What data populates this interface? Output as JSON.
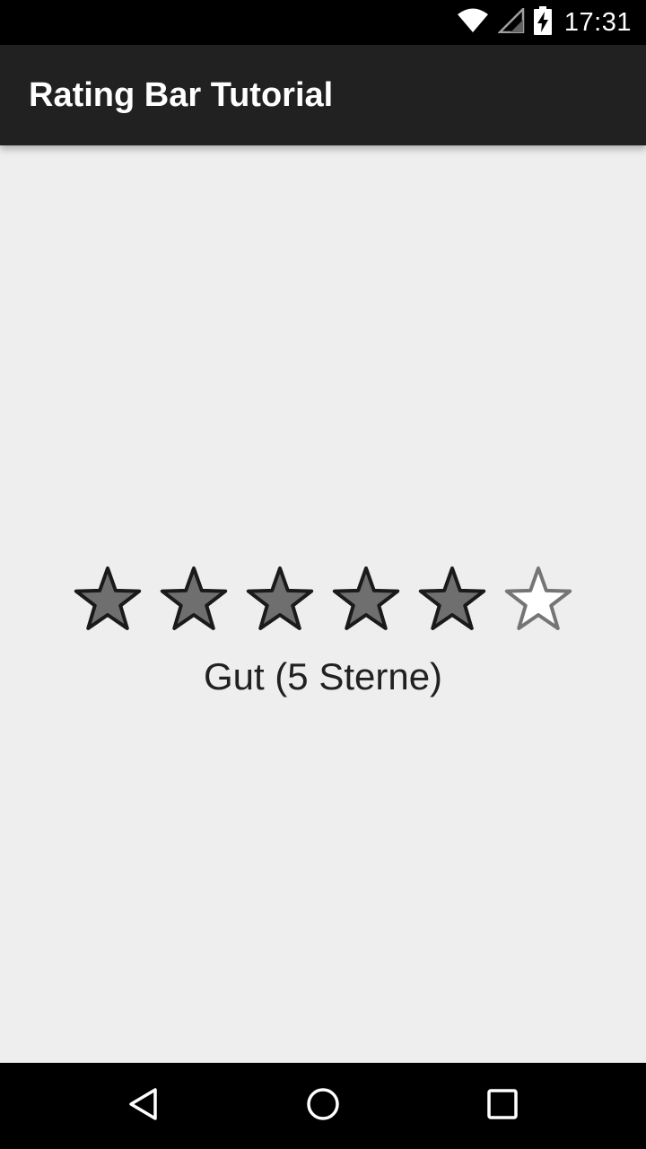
{
  "status_bar": {
    "time": "17:31",
    "icons": [
      "wifi-icon",
      "cell-signal-icon",
      "battery-charging-icon"
    ]
  },
  "app_bar": {
    "title": "Rating Bar Tutorial"
  },
  "rating": {
    "max_stars": 6,
    "filled_stars": 5,
    "label": "Gut (5 Sterne)"
  },
  "nav_bar": {
    "buttons": [
      "back-icon",
      "home-icon",
      "recents-icon"
    ]
  },
  "colors": {
    "status_bar_bg": "#000000",
    "app_bar_bg": "#212121",
    "content_bg": "#eeeeee",
    "star_filled": "#6f6f6f",
    "star_outline": "#1a1a1a",
    "star_empty_outline": "#757575",
    "nav_bar_bg": "#000000"
  }
}
